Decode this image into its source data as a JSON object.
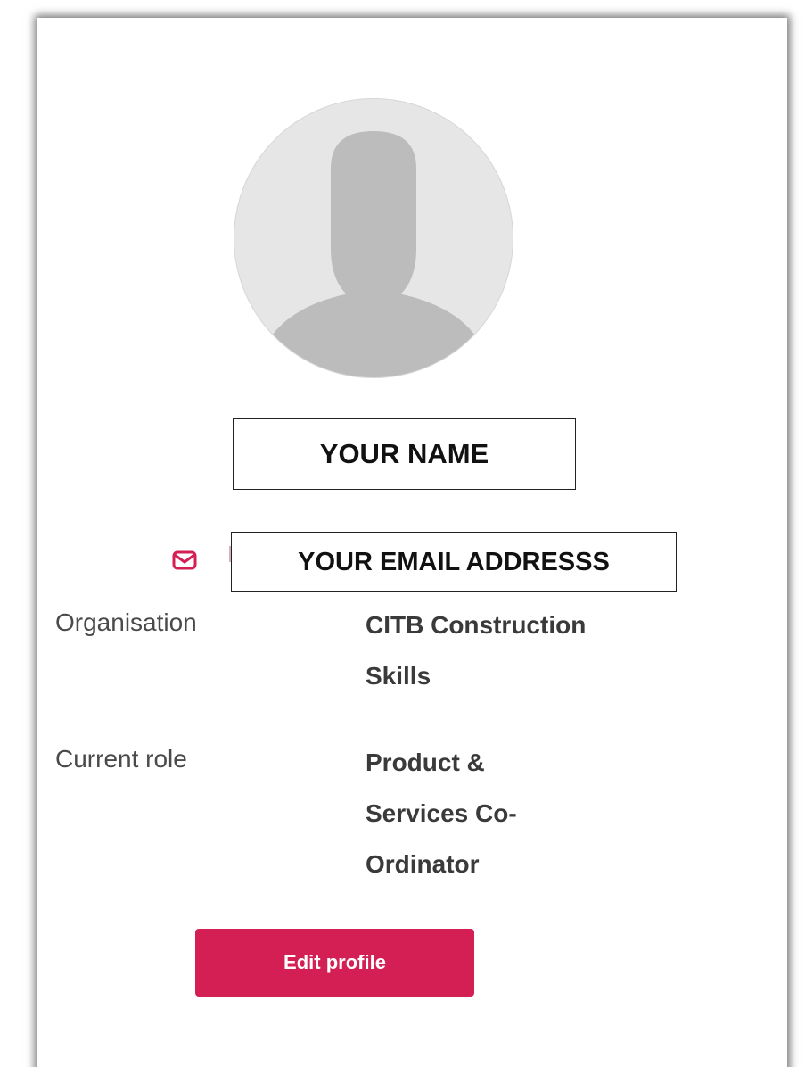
{
  "profile": {
    "name": "YOUR NAME",
    "email": "YOUR EMAIL ADDRESSS",
    "details": [
      {
        "label": "Organisation",
        "value_lines": [
          "CITB Construction",
          "Skills"
        ]
      },
      {
        "label": "Current role",
        "value_lines": [
          "Product &",
          "Services Co-",
          "Ordinator"
        ]
      }
    ],
    "edit_label": "Edit profile"
  },
  "icons": {
    "avatar": "default-avatar-silhouette-icon",
    "email": "envelope-icon"
  },
  "colors": {
    "accent": "#d41f55",
    "avatar_bg": "#e6e6e6",
    "avatar_figure": "#bcbcbc",
    "label_text": "#4a4a4a",
    "value_text": "#3a3a3a"
  }
}
